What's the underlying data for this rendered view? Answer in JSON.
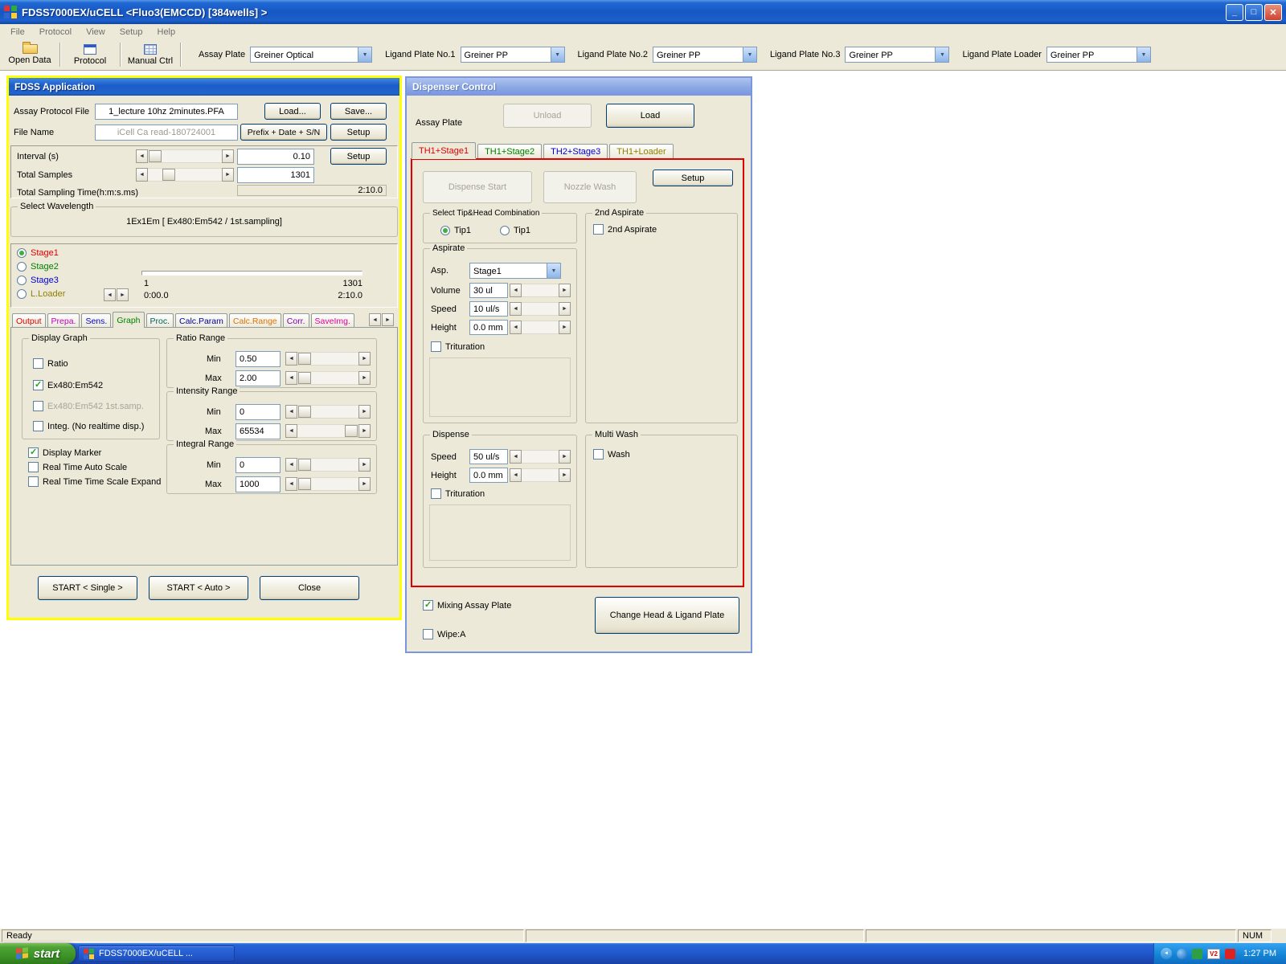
{
  "titlebar": {
    "title": "FDSS7000EX/uCELL <Fluo3(EMCCD) [384wells] >"
  },
  "icons": {
    "minimize": "_",
    "maximize": "□",
    "close": "✕",
    "dropdown": "▼",
    "arrow_left": "◄",
    "arrow_right": "►"
  },
  "menu": {
    "items": [
      "File",
      "Protocol",
      "View",
      "Setup",
      "Help"
    ]
  },
  "toolbar": {
    "buttons": [
      {
        "label": "Open Data",
        "icon": "open-folder-icon"
      },
      {
        "label": "Protocol",
        "icon": "protocol-sheet-icon"
      },
      {
        "label": "Manual Ctrl",
        "icon": "control-grid-icon"
      }
    ],
    "combos": [
      {
        "label": "Assay Plate",
        "value": "Greiner Optical"
      },
      {
        "label": "Ligand Plate No.1",
        "value": "Greiner PP"
      },
      {
        "label": "Ligand Plate No.2",
        "value": "Greiner PP"
      },
      {
        "label": "Ligand Plate No.3",
        "value": "Greiner PP"
      },
      {
        "label": "Ligand Plate Loader",
        "value": "Greiner PP"
      }
    ]
  },
  "fdss": {
    "title": "FDSS Application",
    "protocol_file": {
      "label": "Assay Protocol File",
      "value": "1_lecture 10hz 2minutes.PFA",
      "load": "Load...",
      "save": "Save..."
    },
    "file_name": {
      "label": "File Name",
      "value": "iCell Ca read-180724001",
      "prefix": "Prefix + Date + S/N",
      "setup": "Setup"
    },
    "interval": {
      "label": "Interval (s)",
      "value": "0.10",
      "setup": "Setup"
    },
    "total_samples": {
      "label": "Total Samples",
      "value": "1301"
    },
    "total_time": {
      "label": "Total Sampling Time(h:m:s.ms)",
      "value": "2:10.0"
    },
    "wavelength": {
      "group": "Select Wavelength",
      "value": "1Ex1Em [ Ex480:Em542 / 1st.sampling]"
    },
    "stages": [
      {
        "label": "Stage1",
        "color": "#E00000",
        "selected": true
      },
      {
        "label": "Stage2",
        "color": "#008000",
        "selected": false
      },
      {
        "label": "Stage3",
        "color": "#0000D0",
        "selected": false
      },
      {
        "label": "L.Loader",
        "color": "#908000",
        "selected": false
      }
    ],
    "timeline": {
      "sample_start": "1",
      "sample_end": "1301",
      "time_start": "0:00.0",
      "time_end": "2:10.0"
    },
    "tabs": [
      {
        "label": "Output",
        "color": "#E00000",
        "active": false
      },
      {
        "label": "Prepa.",
        "color": "#C000C0",
        "active": false
      },
      {
        "label": "Sens.",
        "color": "#0000D0",
        "active": false
      },
      {
        "label": "Graph",
        "color": "#008000",
        "active": true
      },
      {
        "label": "Proc.",
        "color": "#006060",
        "active": false
      },
      {
        "label": "Calc.Param",
        "color": "#0000A0",
        "active": false
      },
      {
        "label": "Calc.Range",
        "color": "#E07000",
        "active": false
      },
      {
        "label": "Corr.",
        "color": "#8000C0",
        "active": false
      },
      {
        "label": "SaveImg.",
        "color": "#E000A0",
        "active": false
      }
    ],
    "graph_tab": {
      "display_graph": {
        "group": "Display Graph",
        "items": [
          {
            "label": "Ratio",
            "checked": false
          },
          {
            "label": "Ex480:Em542",
            "checked": true
          },
          {
            "label": "Ex480:Em542 1st.samp.",
            "checked": false,
            "disabled": true
          },
          {
            "label": "Integ. (No realtime disp.)",
            "checked": false
          }
        ]
      },
      "options": [
        {
          "label": "Display Marker",
          "checked": true
        },
        {
          "label": "Real Time Auto Scale",
          "checked": false
        },
        {
          "label": "Real Time Time Scale Expand",
          "checked": false
        }
      ],
      "ratio_range": {
        "group": "Ratio Range",
        "min_label": "Min",
        "min": "0.50",
        "max_label": "Max",
        "max": "2.00"
      },
      "intensity_range": {
        "group": "Intensity Range",
        "min_label": "Min",
        "min": "0",
        "max_label": "Max",
        "max": "65534"
      },
      "integral_range": {
        "group": "Integral Range",
        "min_label": "Min",
        "min": "0",
        "max_label": "Max",
        "max": "1000"
      }
    },
    "buttons": {
      "start_single": "START < Single >",
      "start_auto": "START < Auto >",
      "close": "Close"
    }
  },
  "dispenser": {
    "title": "Dispenser Control",
    "assay_plate_label": "Assay Plate",
    "unload": "Unload",
    "load": "Load",
    "tabs": [
      {
        "label": "TH1+Stage1",
        "color": "#E00000",
        "active": true
      },
      {
        "label": "TH1+Stage2",
        "color": "#008000",
        "active": false
      },
      {
        "label": "TH2+Stage3",
        "color": "#0000D0",
        "active": false
      },
      {
        "label": "TH1+Loader",
        "color": "#908000",
        "active": false
      }
    ],
    "dispense_start": "Dispense Start",
    "nozzle_wash": "Nozzle Wash",
    "setup": "Setup",
    "tip_head": {
      "group": "Select Tip&Head Combination",
      "tip1": {
        "label": "Tip1",
        "selected": true
      },
      "tip2": {
        "label": "Tip1",
        "selected": false
      }
    },
    "aspirate": {
      "group": "Aspirate",
      "asp_label": "Asp.",
      "asp_value": "Stage1",
      "volume_label": "Volume",
      "volume": "30 ul",
      "speed_label": "Speed",
      "speed": "10 ul/s",
      "height_label": "Height",
      "height": "0.0 mm",
      "trituration": {
        "label": "Trituration",
        "checked": false
      }
    },
    "second_aspirate": {
      "group": "2nd Aspirate",
      "checkbox": {
        "label": "2nd Aspirate",
        "checked": false
      }
    },
    "dispense": {
      "group": "Dispense",
      "speed_label": "Speed",
      "speed": "50 ul/s",
      "height_label": "Height",
      "height": "0.0 mm",
      "trituration": {
        "label": "Trituration",
        "checked": false
      }
    },
    "multi_wash": {
      "group": "Multi Wash",
      "wash": {
        "label": "Wash",
        "checked": false
      }
    },
    "mixing": {
      "label": "Mixing Assay Plate",
      "checked": true
    },
    "wipe": {
      "label": "Wipe:A",
      "checked": false
    },
    "change_head": "Change Head & Ligand Plate"
  },
  "statusbar": {
    "ready": "Ready",
    "num": "NUM"
  },
  "taskbar": {
    "start": "start",
    "task": "FDSS7000EX/uCELL ...",
    "time": "1:27 PM",
    "tray_v2": "V2"
  },
  "colors": {
    "fdss_highlight_frame": "#FFFF00",
    "dispenser_attention_frame": "#E00000"
  }
}
